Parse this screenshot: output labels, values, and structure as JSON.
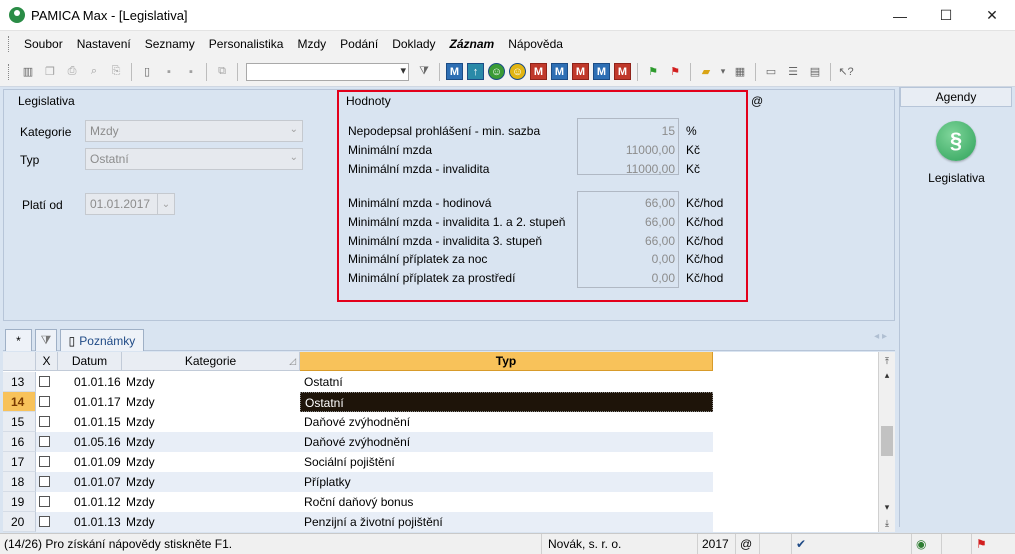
{
  "window": {
    "title": "PAMICA Max - [Legislativa]",
    "minimize": "—",
    "maximize": "☐",
    "close": "✕"
  },
  "menu": [
    "Soubor",
    "Nastavení",
    "Seznamy",
    "Personalistika",
    "Mzdy",
    "Podání",
    "Doklady",
    "Záznam",
    "Nápověda"
  ],
  "form": {
    "section_title": "Legislativa",
    "kategorie_label": "Kategorie",
    "kategorie_value": "Mzdy",
    "typ_label": "Typ",
    "typ_value": "Ostatní",
    "plati_od_label": "Platí od",
    "plati_od_value": "01.01.2017",
    "at_symbol": "@"
  },
  "hodnoty": {
    "title": "Hodnoty",
    "group1": [
      {
        "label": "Nepodepsal prohlášení - min. sazba",
        "value": "15",
        "unit": "%"
      },
      {
        "label": "Minimální mzda",
        "value": "11000,00",
        "unit": "Kč"
      },
      {
        "label": "Minimální mzda - invalidita",
        "value": "11000,00",
        "unit": "Kč"
      }
    ],
    "group2": [
      {
        "label": "Minimální mzda - hodinová",
        "value": "66,00",
        "unit": "Kč/hod"
      },
      {
        "label": "Minimální mzda - invalidita 1. a 2. stupeň",
        "value": "66,00",
        "unit": "Kč/hod"
      },
      {
        "label": "Minimální mzda - invalidita 3. stupeň",
        "value": "66,00",
        "unit": "Kč/hod"
      },
      {
        "label": "Minimální příplatek za noc",
        "value": "0,00",
        "unit": "Kč/hod"
      },
      {
        "label": "Minimální příplatek za prostředí",
        "value": "0,00",
        "unit": "Kč/hod"
      }
    ]
  },
  "agendy": {
    "header": "Agendy",
    "icon_glyph": "§",
    "item_label": "Legislativa"
  },
  "tabs": {
    "star": "*",
    "notes": "Poznámky",
    "arrows": "◂ ▸"
  },
  "grid": {
    "columns": [
      "X",
      "Datum",
      "Kategorie",
      "Typ"
    ],
    "rows": [
      {
        "n": "13",
        "datum": "01.01.16",
        "kategorie": "Mzdy",
        "typ": "Ostatní"
      },
      {
        "n": "14",
        "datum": "01.01.17",
        "kategorie": "Mzdy",
        "typ": "Ostatní"
      },
      {
        "n": "15",
        "datum": "01.01.15",
        "kategorie": "Mzdy",
        "typ": "Daňové zvýhodnění"
      },
      {
        "n": "16",
        "datum": "01.05.16",
        "kategorie": "Mzdy",
        "typ": "Daňové zvýhodnění"
      },
      {
        "n": "17",
        "datum": "01.01.09",
        "kategorie": "Mzdy",
        "typ": "Sociální pojištění"
      },
      {
        "n": "18",
        "datum": "01.01.07",
        "kategorie": "Mzdy",
        "typ": "Příplatky"
      },
      {
        "n": "19",
        "datum": "01.01.12",
        "kategorie": "Mzdy",
        "typ": "Roční daňový bonus"
      },
      {
        "n": "20",
        "datum": "01.01.13",
        "kategorie": "Mzdy",
        "typ": "Penzijní a životní pojištění"
      }
    ],
    "selected_row": "14"
  },
  "status": {
    "help": "(14/26) Pro získání nápovědy stiskněte F1.",
    "company": "Novák, s. r. o.",
    "year": "2017",
    "at": "@"
  },
  "colors": {
    "highlight_border": "#e3001b",
    "selected_row_bg": "#1e1409",
    "active_header": "#f8c25a"
  }
}
